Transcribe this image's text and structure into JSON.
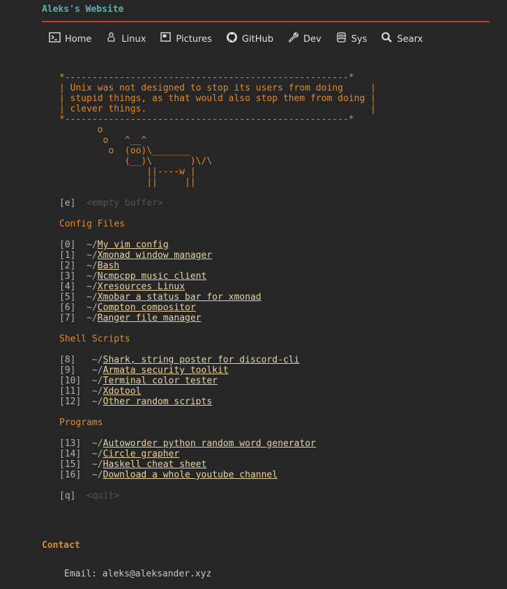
{
  "site": {
    "title": "Aleks's Website"
  },
  "nav": [
    {
      "label": "Home",
      "icon": "terminal-icon"
    },
    {
      "label": "Linux",
      "icon": "tux-icon"
    },
    {
      "label": "Pictures",
      "icon": "picture-icon"
    },
    {
      "label": "GitHub",
      "icon": "github-icon"
    },
    {
      "label": "Dev",
      "icon": "wrench-icon"
    },
    {
      "label": "Sys",
      "icon": "database-icon"
    },
    {
      "label": "Searx",
      "icon": "search-icon"
    }
  ],
  "fortune": {
    "text": "*----------------------------------------------------*\n| Unix was not designed to stop its users from doing     |\n| stupid things, as that would also stop them from doing |\n| clever things.                                         |\n*----------------------------------------------------*\n       o\n        o   ^__^\n         o  (oo)\\_______\n            (__)\\       )\\/\\\n                ||----w |\n                ||     ||"
  },
  "empty_buffer": {
    "key": "[e]",
    "label": "<empty buffer>"
  },
  "config": {
    "heading": "Config Files",
    "items": [
      {
        "index": "[0]",
        "prefix": "~/",
        "label": "My vim config"
      },
      {
        "index": "[1]",
        "prefix": "~/",
        "label": "Xmonad window manager"
      },
      {
        "index": "[2]",
        "prefix": "~/",
        "label": "Bash"
      },
      {
        "index": "[3]",
        "prefix": "~/",
        "label": "Ncmpcpp music client"
      },
      {
        "index": "[4]",
        "prefix": "~/",
        "label": "Xresources Linux"
      },
      {
        "index": "[5]",
        "prefix": "~/",
        "label": "Xmobar a status bar for xmonad"
      },
      {
        "index": "[6]",
        "prefix": "~/",
        "label": "Compton compositor"
      },
      {
        "index": "[7]",
        "prefix": "~/",
        "label": "Ranger file manager"
      }
    ]
  },
  "scripts": {
    "heading": "Shell Scripts",
    "items": [
      {
        "index": "[8]",
        "prefix": "~/",
        "label": "Shark, string poster for discord-cli"
      },
      {
        "index": "[9]",
        "prefix": "~/",
        "label": "Armata security toolkit"
      },
      {
        "index": "[10]",
        "prefix": "~/",
        "label": "Terminal color tester"
      },
      {
        "index": "[11]",
        "prefix": "~/",
        "label": "Xdotool"
      },
      {
        "index": "[12]",
        "prefix": "~/",
        "label": "Other random scripts"
      }
    ]
  },
  "programs": {
    "heading": "Programs",
    "items": [
      {
        "index": "[13]",
        "prefix": "~/",
        "label": "Autoworder python random word generator"
      },
      {
        "index": "[14]",
        "prefix": "~/",
        "label": "Circle grapher"
      },
      {
        "index": "[15]",
        "prefix": "~/",
        "label": "Haskell cheat sheet"
      },
      {
        "index": "[16]",
        "prefix": "~/",
        "label": "Download a whole youtube channel"
      }
    ]
  },
  "quit": {
    "key": "[q]",
    "label": "<quit>"
  },
  "contact": {
    "heading": "Contact",
    "email_label": "Email:",
    "email": "aleks@aleksander.xyz"
  },
  "colors": {
    "background": "#262626",
    "accent": "#e08a2c",
    "title": "#5fafaf",
    "rule": "#c0392b",
    "link": "#e8d3a0"
  }
}
